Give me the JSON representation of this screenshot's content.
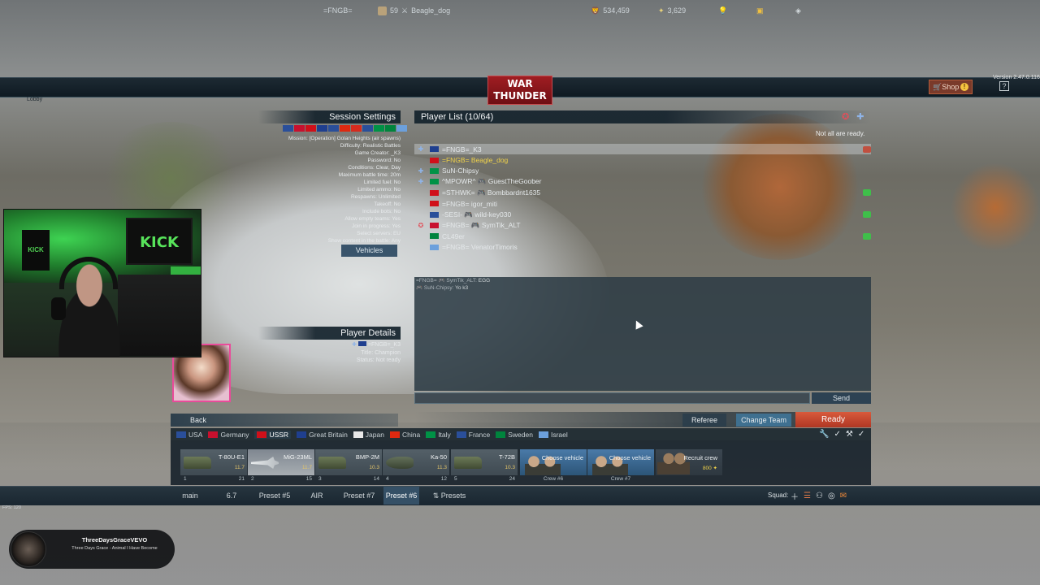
{
  "topbar": {
    "squadron": "=FNGB=",
    "level": "59",
    "player_name": "Beagle_dog",
    "logo_line1": "WAR",
    "logo_line2": "THUNDER",
    "silver_lions": "534,459",
    "research": "3,629",
    "shop_label": "Shop",
    "shop_badge": "!",
    "help_label": "?",
    "version": "Version 2.47.0.116"
  },
  "lobby_label": "Lobby",
  "session": {
    "title": "Session Settings",
    "flag_colors": [
      "#2a4f9a",
      "#c8102e",
      "#d0101a",
      "#1f3f8f",
      "#2a4f9a",
      "#de2910",
      "#d52b1e",
      "#2a4f9a",
      "#009246",
      "#00843d",
      "#6ca0dc"
    ],
    "lines": [
      "Mission: [Operation] Golan Heights (air spawns)",
      "Difficulty: Realistic Battles",
      "Game Creator: _K3",
      "Password: No",
      "Conditions: Clear, Day",
      "Maximum battle time: 20m",
      "Limited fuel: No",
      "Limited ammo: No",
      "Respawns: Unlimited",
      "Takeoff: No",
      "Include bots: No",
      "Allow empty teams: Yes",
      "Join in progress: Yes",
      "Select servers: EU",
      "Show content in the battle: Any"
    ],
    "vehicles_button": "Vehicles"
  },
  "player_list": {
    "title": "Player List (10/64)",
    "ready_note": "Not all are ready.",
    "players": [
      {
        "tag": "✚",
        "flag": "#1f3f8f",
        "name": "=FNGB=_K3",
        "highlight": false,
        "selected": true,
        "status": "#c05040"
      },
      {
        "tag": "",
        "flag": "#d0101a",
        "name": "=FNGB= Beagle_dog",
        "highlight": true,
        "selected": false,
        "status": ""
      },
      {
        "tag": "✚",
        "flag": "#009246",
        "name": "SuN-Chipsy",
        "highlight": false,
        "selected": false,
        "status": ""
      },
      {
        "tag": "✚",
        "flag": "#009246",
        "name": "^MPOWR^ 🎮 GuestTheGoober",
        "highlight": false,
        "selected": false,
        "status": ""
      },
      {
        "tag": "",
        "flag": "#d0101a",
        "name": "=STHWK= 🎮 Bombbardnt1635",
        "highlight": false,
        "selected": false,
        "status": "#3fbf4a"
      },
      {
        "tag": "",
        "flag": "#d0101a",
        "name": "=FNGB= igor_miti",
        "highlight": false,
        "selected": false,
        "status": ""
      },
      {
        "tag": "",
        "flag": "#2a4f9a",
        "name": "-SESI- 🎮 wild-key030",
        "highlight": false,
        "selected": false,
        "status": "#3fbf4a"
      },
      {
        "tag": "✪",
        "flag": "#c8102e",
        "name": "=FNGB= 🎮 SymTik_ALT",
        "highlight": false,
        "selected": false,
        "status": ""
      },
      {
        "tag": "",
        "flag": "#00843d",
        "name": "CL49er",
        "highlight": false,
        "selected": false,
        "status": "#3fbf4a"
      },
      {
        "tag": "",
        "flag": "#6ca0dc",
        "name": "=FNGB= VenatorTimoris",
        "highlight": false,
        "selected": false,
        "status": ""
      }
    ]
  },
  "chat": {
    "messages": [
      {
        "sender": "=FNGB= 🎮 SymTik_ALT:",
        "text": "EGG"
      },
      {
        "sender": "🎮 SuN-Chipsy:",
        "text": "Yo k3"
      }
    ],
    "send_label": "Send"
  },
  "player_details": {
    "title": "Player Details",
    "name": "=FNGB=_K3",
    "title_line": "Title: Champion",
    "status_line": "Status: Not ready"
  },
  "buttons": {
    "back": "Back",
    "referee": "Referee",
    "change_team": "Change Team",
    "ready": "Ready"
  },
  "nations": [
    {
      "name": "USA",
      "color": "#2a4f9a",
      "active": false
    },
    {
      "name": "Germany",
      "color": "#c8102e",
      "active": false
    },
    {
      "name": "USSR",
      "color": "#d0101a",
      "active": true
    },
    {
      "name": "Great Britain",
      "color": "#1f3f8f",
      "active": false
    },
    {
      "name": "Japan",
      "color": "#e8e8e8",
      "active": false
    },
    {
      "name": "China",
      "color": "#de2910",
      "active": false
    },
    {
      "name": "Italy",
      "color": "#009246",
      "active": false
    },
    {
      "name": "France",
      "color": "#2a4f9a",
      "active": false
    },
    {
      "name": "Sweden",
      "color": "#00843d",
      "active": false
    },
    {
      "name": "Israel",
      "color": "#6ca0dc",
      "active": false
    }
  ],
  "slots": [
    {
      "name": "T-80U-E1",
      "br": "11.7",
      "index": "1",
      "extra": "21",
      "kind": "tank",
      "active": false
    },
    {
      "name": "MiG-23ML",
      "br": "11.7",
      "index": "2",
      "extra": "15",
      "kind": "jet",
      "active": true
    },
    {
      "name": "BMP-2M",
      "br": "10.3",
      "index": "3",
      "extra": "14",
      "kind": "tank",
      "active": false
    },
    {
      "name": "Ka-50",
      "br": "11.3",
      "index": "4",
      "extra": "12",
      "kind": "heli",
      "active": false
    },
    {
      "name": "T-72B",
      "br": "10.3",
      "index": "5",
      "extra": "24",
      "kind": "tank",
      "active": false
    }
  ],
  "crew_slots": [
    {
      "label": "Choose vehicle",
      "crew": "Crew #6"
    },
    {
      "label": "Choose vehicle",
      "crew": "Crew #7"
    }
  ],
  "recruit": {
    "label": "Recruit crew",
    "cost": "800"
  },
  "presets": [
    {
      "label": "main",
      "active": false
    },
    {
      "label": "6.7",
      "active": false
    },
    {
      "label": "Preset #5",
      "active": false
    },
    {
      "label": "AIR",
      "active": false
    },
    {
      "label": "Preset #7",
      "active": false
    },
    {
      "label": "Preset #6",
      "active": true
    },
    {
      "label": "⇅ Presets",
      "active": false
    }
  ],
  "squad_label": "Squad:",
  "fps": "FPS: 120",
  "webcam": {
    "sign": "KICK",
    "sign_small": "KICK"
  },
  "music": {
    "artist": "ThreeDaysGraceVEVO",
    "song": "Three Days Grace - Animal I Have Become"
  }
}
